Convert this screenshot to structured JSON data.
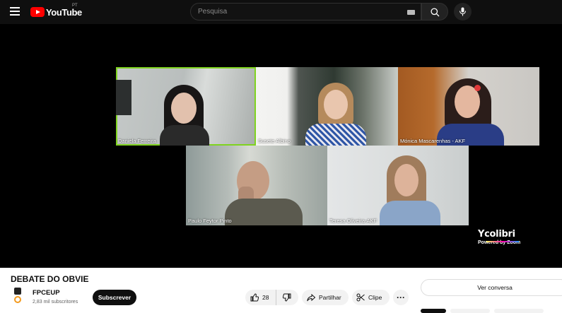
{
  "header": {
    "logo_text": "YouTube",
    "logo_country": "PT",
    "search_placeholder": "Pesquisa"
  },
  "player": {
    "participants": [
      {
        "name": "Daniela Ferreira",
        "active": true
      },
      {
        "name": "Susete Albino",
        "active": false
      },
      {
        "name": "Mónica Mascarenhas - AKF",
        "active": false
      },
      {
        "name": "Paulo Feytor Pinto",
        "active": false
      },
      {
        "name": "Teresa Oliveira-AKF",
        "active": false
      }
    ],
    "brand_name": "colibri",
    "brand_sub": "Powered by Zoom"
  },
  "video": {
    "title": "DEBATE DO OBVIE",
    "channel_name": "FPCEUP",
    "subscribers": "2,83 mil subscritores",
    "subscribe_label": "Subscrever",
    "likes": "28",
    "share_label": "Partilhar",
    "clip_label": "Clipe",
    "more_label": "···"
  },
  "side": {
    "chat_label": "Ver conversa"
  },
  "colors": {
    "accent": "#ff0000",
    "active_speaker": "#7fd31f",
    "masthead": "#0f0f0f"
  }
}
